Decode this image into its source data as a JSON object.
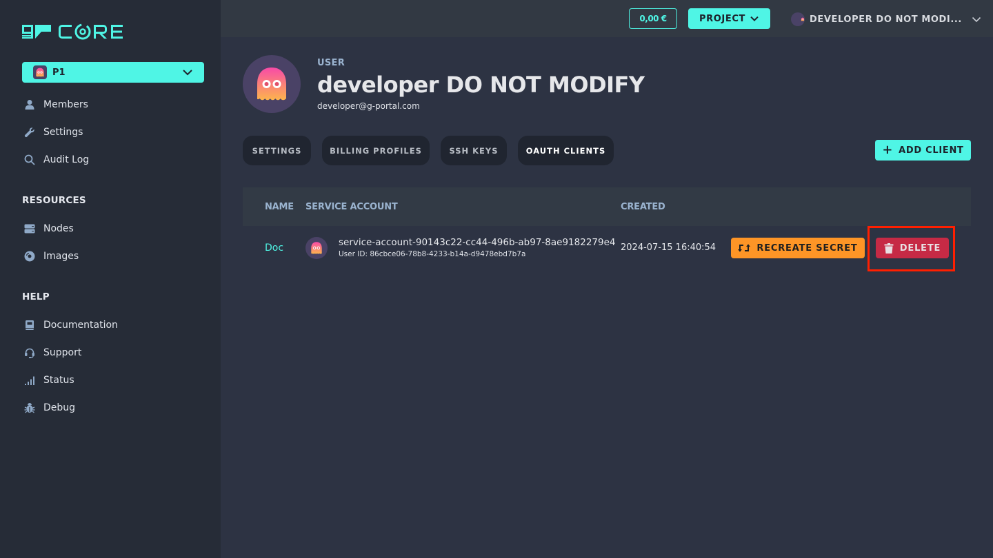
{
  "brand": {
    "logo_text": "CORE",
    "accent": "#4ff5e5"
  },
  "sidebar": {
    "project": {
      "name": "P1"
    },
    "items": [
      {
        "label": "Members",
        "icon": "user-icon"
      },
      {
        "label": "Settings",
        "icon": "wrench-icon"
      },
      {
        "label": "Audit Log",
        "icon": "search-icon"
      }
    ],
    "sections": [
      {
        "heading": "RESOURCES",
        "items": [
          {
            "label": "Nodes",
            "icon": "server-icon"
          },
          {
            "label": "Images",
            "icon": "disc-icon"
          }
        ]
      },
      {
        "heading": "HELP",
        "items": [
          {
            "label": "Documentation",
            "icon": "book-icon"
          },
          {
            "label": "Support",
            "icon": "headset-icon"
          },
          {
            "label": "Status",
            "icon": "signal-icon"
          },
          {
            "label": "Debug",
            "icon": "bug-icon"
          }
        ]
      }
    ]
  },
  "topbar": {
    "balance": "0,00 €",
    "project_label": "PROJECT",
    "user_label": "DEVELOPER DO NOT MODI..."
  },
  "header": {
    "label": "USER",
    "title": "developer DO NOT MODIFY",
    "email": "developer@g-portal.com"
  },
  "tabs": [
    {
      "label": "SETTINGS",
      "active": false
    },
    {
      "label": "BILLING PROFILES",
      "active": false
    },
    {
      "label": "SSH KEYS",
      "active": false
    },
    {
      "label": "OAUTH CLIENTS",
      "active": true
    }
  ],
  "actions": {
    "add_client": "ADD CLIENT"
  },
  "table": {
    "columns": [
      "NAME",
      "SERVICE ACCOUNT",
      "CREATED"
    ],
    "rows": [
      {
        "name": "Doc",
        "service_account": "service-account-90143c22-cc44-496b-ab97-8ae9182279e4",
        "user_id": "User ID: 86cbce06-78b8-4233-b14a-d9478ebd7b7a",
        "created": "2024-07-15 16:40:54",
        "recreate_label": "RECREATE SECRET",
        "delete_label": "DELETE"
      }
    ]
  },
  "colors": {
    "accent": "#4ff5e5",
    "warning": "#fe9526",
    "danger": "#c62a45",
    "highlight": "#ff1f00"
  }
}
